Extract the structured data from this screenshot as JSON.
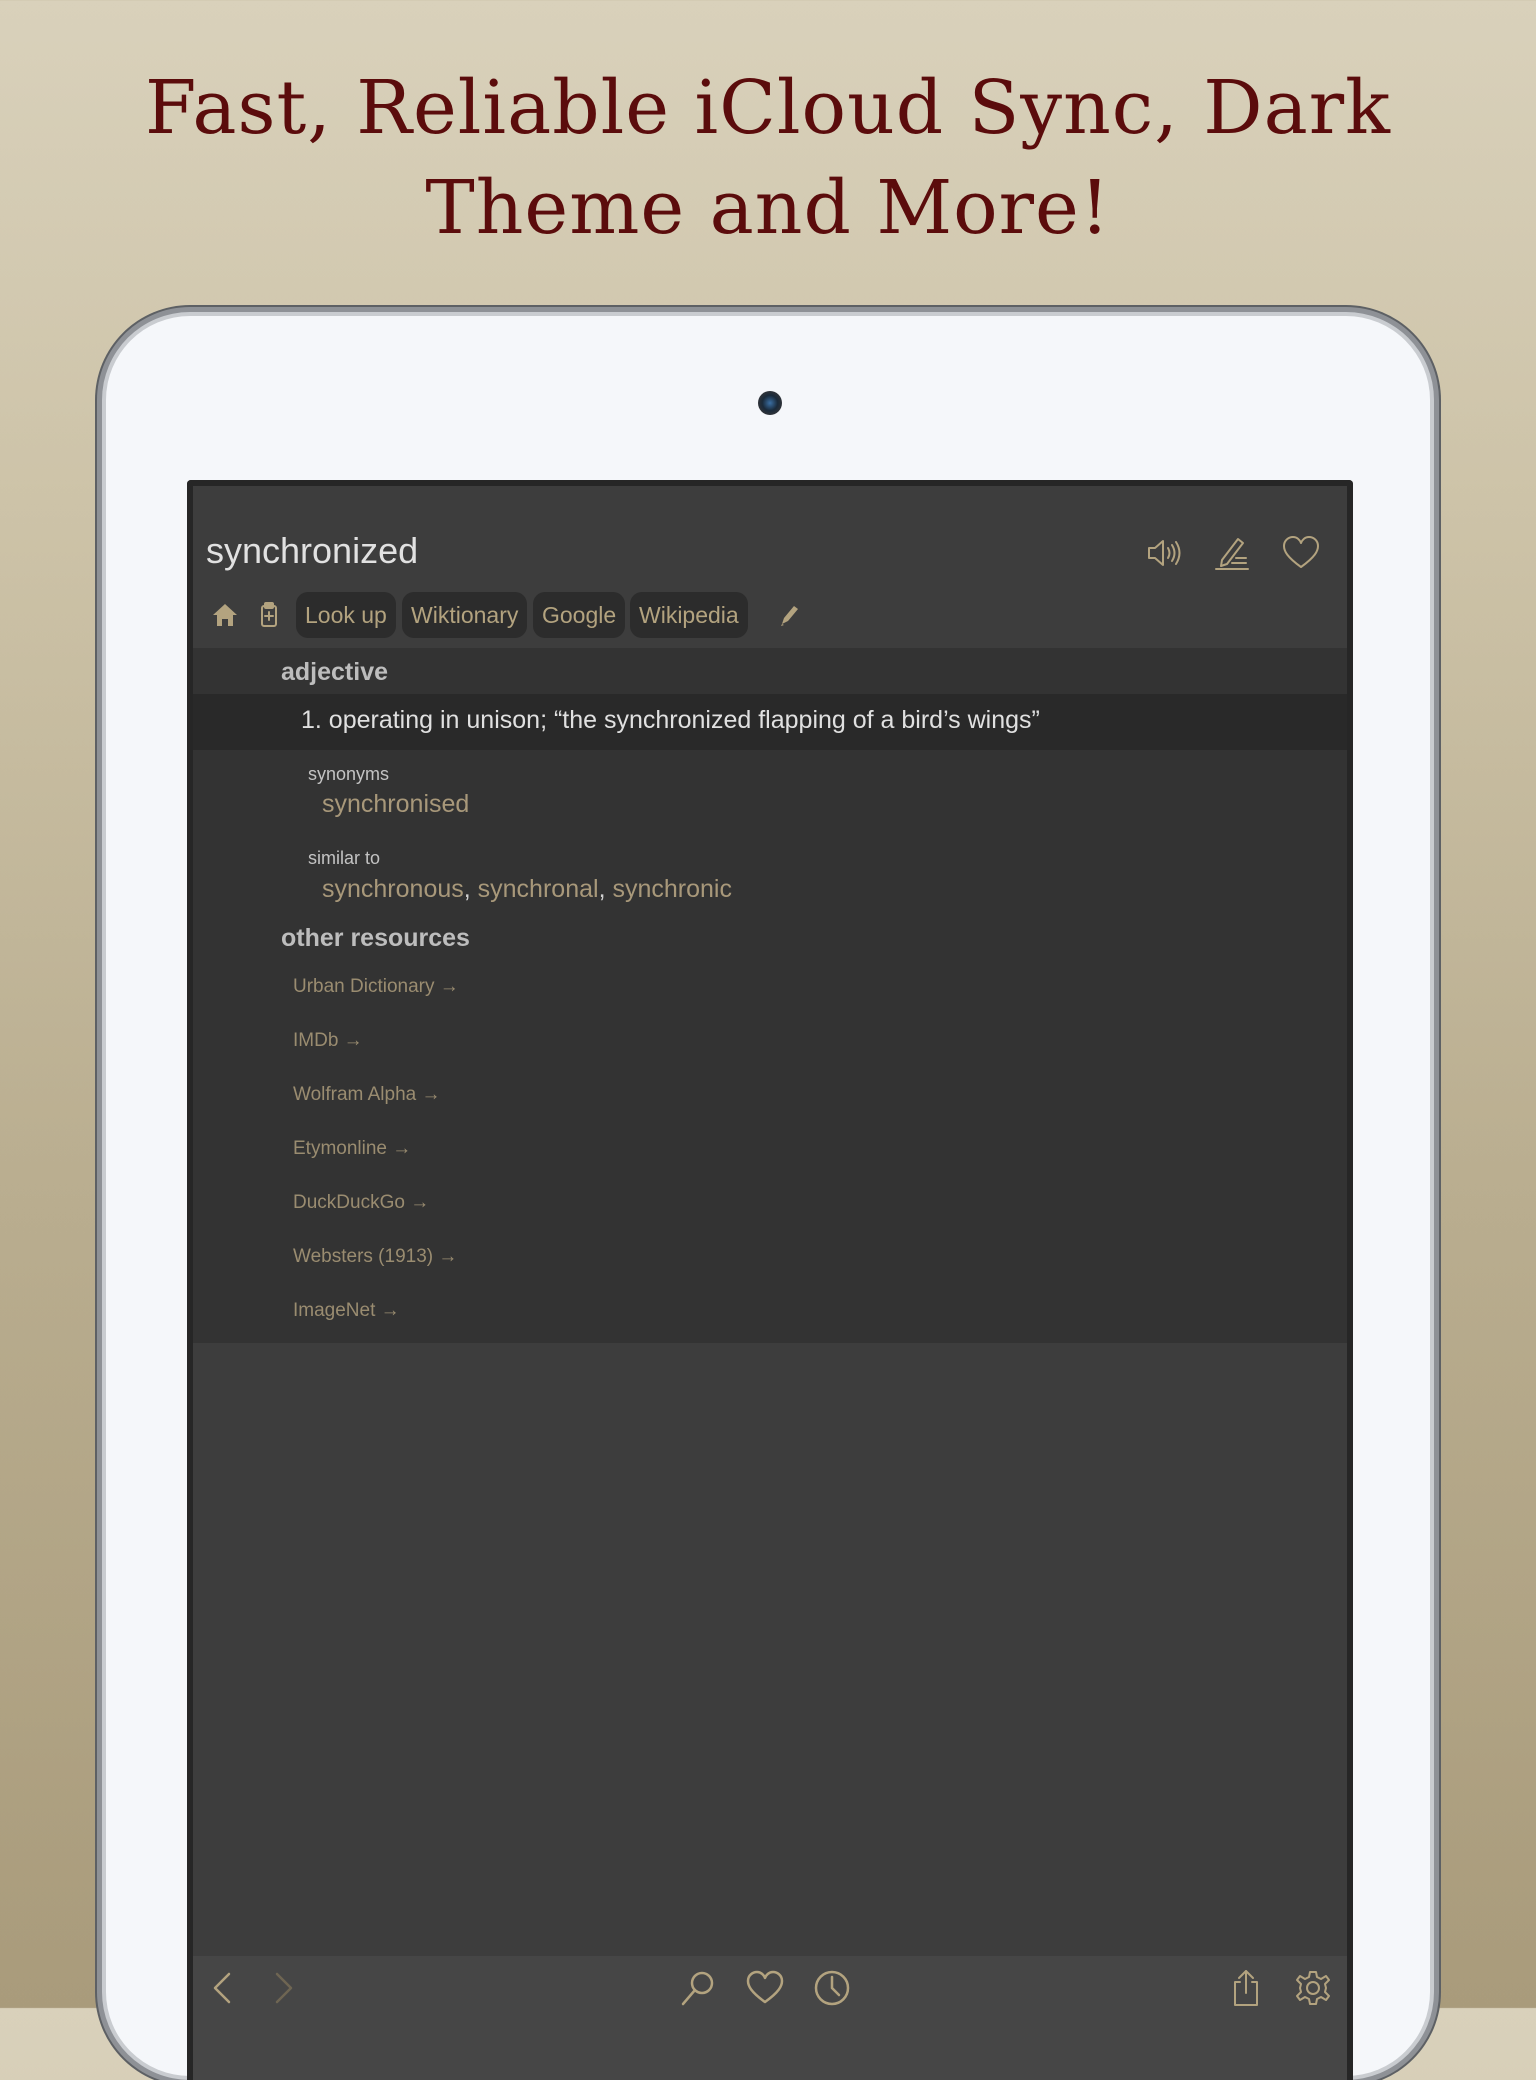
{
  "headline": {
    "line1": "Fast, Reliable iCloud Sync, Dark",
    "line2": "Theme and More!"
  },
  "entry": {
    "word": "synchronized",
    "header_icons": [
      "speaker-icon",
      "edit-note-icon",
      "heart-icon"
    ]
  },
  "toolbar": {
    "icons": [
      "home-icon",
      "clipboard-add-icon",
      "pencil-icon"
    ],
    "buttons": [
      "Look up",
      "Wiktionary",
      "Google",
      "Wikipedia"
    ]
  },
  "definition": {
    "part_of_speech": "adjective",
    "sense": "1. operating in unison; “the synchronized flapping of a bird’s wings”",
    "synonyms_label": "synonyms",
    "synonyms": [
      "synchronised"
    ],
    "similar_label": "similar to",
    "similar": [
      "synchronous",
      "synchronal",
      "synchronic"
    ]
  },
  "resources": {
    "title": "other resources",
    "items": [
      "Urban Dictionary →",
      "IMDb →",
      "Wolfram Alpha →",
      "Etymonline →",
      "DuckDuckGo →",
      "Websters (1913) →",
      "ImageNet →"
    ]
  },
  "bottombar": {
    "icons": [
      "back-icon",
      "forward-icon",
      "search-icon",
      "favorites-icon",
      "history-icon",
      "share-icon",
      "settings-icon"
    ]
  },
  "colors": {
    "headline": "#5b0c0c",
    "accent": "#b3a37f",
    "screen_bg": "#3d3d3d"
  }
}
